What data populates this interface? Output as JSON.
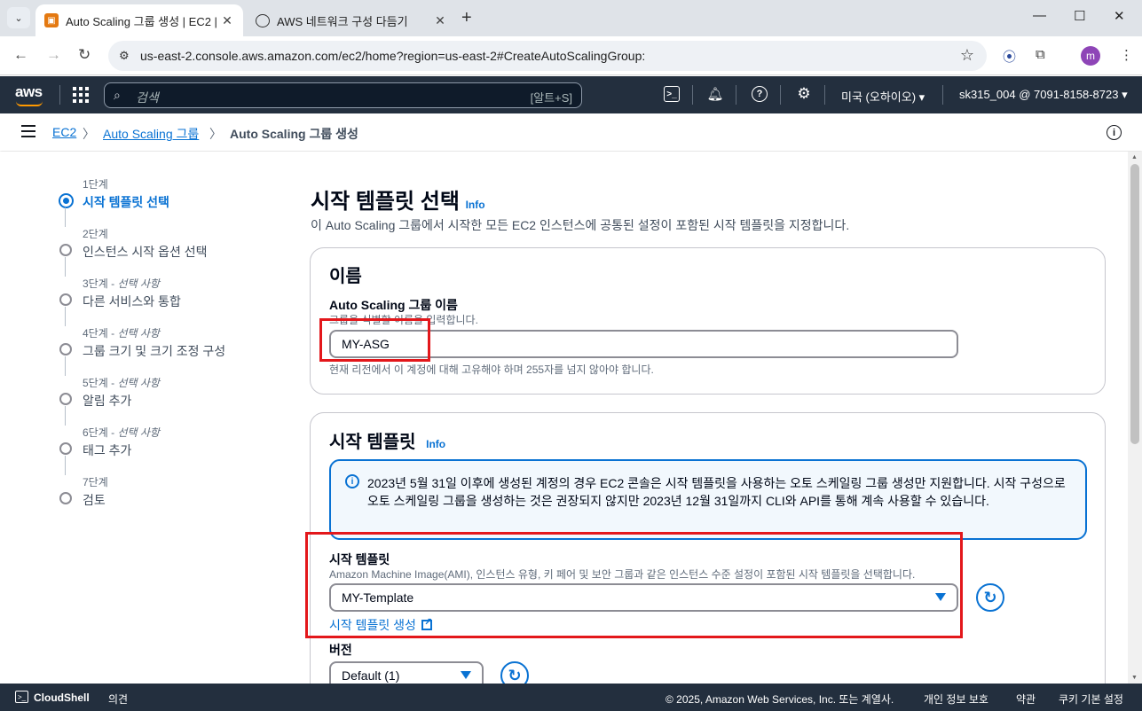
{
  "browser": {
    "tabs": [
      {
        "title": "Auto Scaling 그룹 생성 | EC2 |",
        "active": true
      },
      {
        "title": "AWS 네트워크 구성 다듬기",
        "active": false
      }
    ],
    "url": "us-east-2.console.aws.amazon.com/ec2/home?region=us-east-2#CreateAutoScalingGroup:",
    "profile_initial": "m"
  },
  "aws_nav": {
    "logo": "aws",
    "search_placeholder": "검색",
    "search_shortcut": "[알트+S]",
    "region": "미국 (오하이오)",
    "account": "sk315_004 @ 7091-8158-8723"
  },
  "breadcrumb": {
    "items": [
      "EC2",
      "Auto Scaling 그룹",
      "Auto Scaling 그룹 생성"
    ]
  },
  "steps": [
    {
      "num": "1단계",
      "optional": "",
      "label": "시작 템플릿 선택",
      "active": true
    },
    {
      "num": "2단계",
      "optional": "",
      "label": "인스턴스 시작 옵션 선택",
      "active": false
    },
    {
      "num": "3단계",
      "optional": "선택 사항",
      "label": "다른 서비스와 통합",
      "active": false
    },
    {
      "num": "4단계",
      "optional": "선택 사항",
      "label": "그룹 크기 및 크기 조정 구성",
      "active": false
    },
    {
      "num": "5단계",
      "optional": "선택 사항",
      "label": "알림 추가",
      "active": false
    },
    {
      "num": "6단계",
      "optional": "선택 사항",
      "label": "태그 추가",
      "active": false
    },
    {
      "num": "7단계",
      "optional": "",
      "label": "검토",
      "active": false
    }
  ],
  "page": {
    "title": "시작 템플릿 선택",
    "info": "Info",
    "subtitle": "이 Auto Scaling 그룹에서 시작한 모든 EC2 인스턴스에 공통된 설정이 포함된 시작 템플릿을 지정합니다."
  },
  "name_section": {
    "heading": "이름",
    "label": "Auto Scaling 그룹 이름",
    "description": "그룹을 식별할 이름을 입력합니다.",
    "value": "MY-ASG",
    "constraint": "현재 리전에서 이 계정에 대해 고유해야 하며 255자를 넘지 않아야 합니다."
  },
  "template_section": {
    "heading": "시작 템플릿",
    "info": "Info",
    "alert": "2023년 5월 31일 이후에 생성된 계정의 경우 EC2 콘솔은 시작 템플릿을 사용하는 오토 스케일링 그룹 생성만 지원합니다. 시작 구성으로 오토 스케일링 그룹을 생성하는 것은 권장되지 않지만 2023년 12월 31일까지 CLI와 API를 통해 계속 사용할 수 있습니다.",
    "label": "시작 템플릿",
    "description": "Amazon Machine Image(AMI), 인스턴스 유형, 키 페어 및 보안 그룹과 같은 인스턴스 수준 설정이 포함된 시작 템플릿을 선택합니다.",
    "selected": "MY-Template",
    "create_link": "시작 템플릿 생성",
    "version_label": "버전",
    "version_selected": "Default (1)"
  },
  "footer": {
    "cloudshell": "CloudShell",
    "feedback": "의견",
    "copyright": "© 2025, Amazon Web Services, Inc. 또는 계열사.",
    "privacy": "개인 정보 보호",
    "terms": "약관",
    "cookies": "쿠키 기본 설정"
  },
  "colors": {
    "aws_nav_bg": "#232f3e",
    "link": "#0972d3",
    "highlight": "#e3171b",
    "aws_orange": "#ff9900"
  }
}
